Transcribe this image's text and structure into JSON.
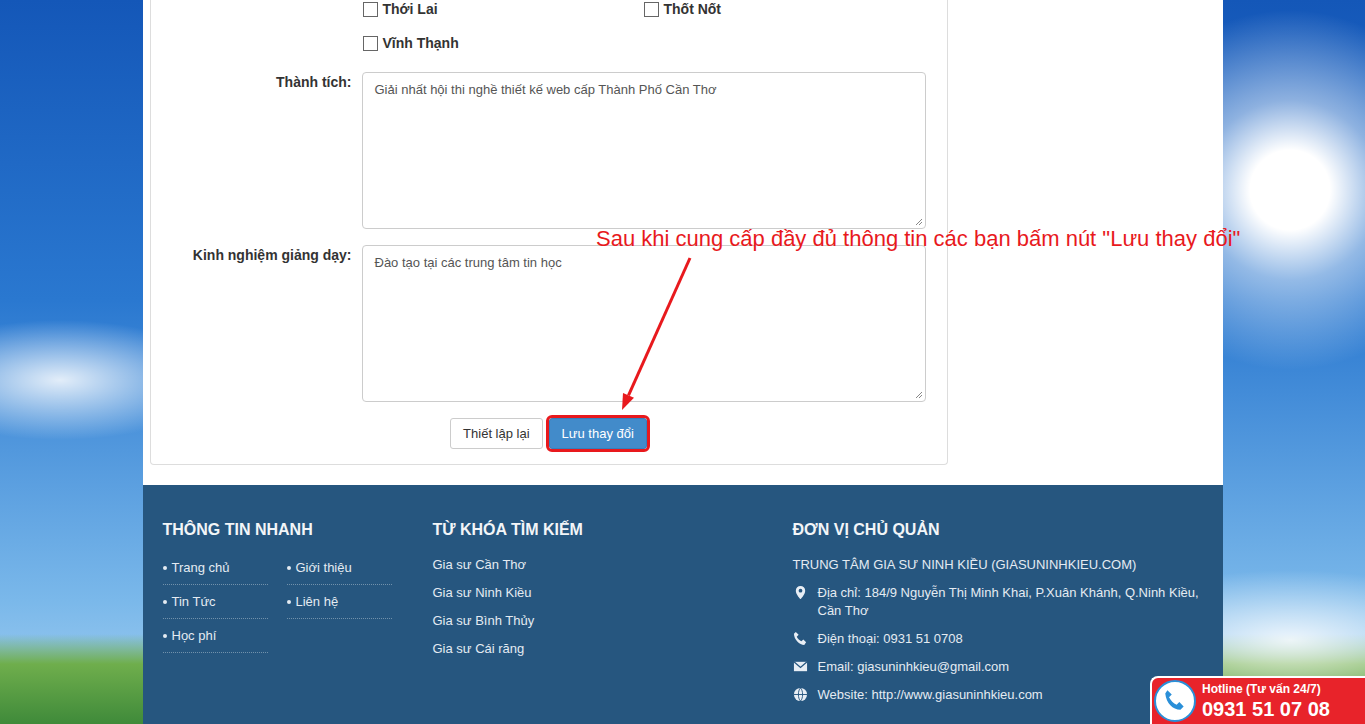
{
  "districts": [
    {
      "label": "Thới Lai",
      "checked": false
    },
    {
      "label": "Thốt Nốt",
      "checked": false
    },
    {
      "label": "Vĩnh Thạnh",
      "checked": false
    }
  ],
  "fields": [
    {
      "label": "Thành tích:",
      "value": "Giải nhất hội thi nghề thiết kế web cấp Thành Phố Cần Thơ"
    },
    {
      "label": "Kinh nghiệm giảng dạy:",
      "value": "Đào tạo tại các trung tâm tin học"
    }
  ],
  "buttons": {
    "reset": "Thiết lập lại",
    "save": "Lưu thay đổi"
  },
  "annotation": "Sau khi cung cấp đầy đủ thông tin các bạn bấm nút \"Lưu thay đổi\"",
  "footer": {
    "quick_info": {
      "title": "THÔNG TIN NHANH",
      "links": [
        "Trang chủ",
        "Giới thiệu",
        "Tin Tức",
        "Liên hệ",
        "Học phí"
      ]
    },
    "keywords": {
      "title": "TỪ KHÓA TÌM KIẾM",
      "links": [
        "Gia sư Cần Thơ",
        "Gia sư Ninh Kiều",
        "Gia sư Bình Thủy",
        "Gia sư Cái răng"
      ]
    },
    "owner": {
      "title": "ĐƠN VỊ CHỦ QUẢN",
      "name": "TRUNG TÂM GIA SƯ NINH KIỀU (GIASUNINHKIEU.COM)",
      "contacts": [
        {
          "kind": "address",
          "text": "Địa chỉ: 184/9 Nguyễn Thị Minh Khai, P.Xuân Khánh, Q.Ninh Kiều, Cần Thơ"
        },
        {
          "kind": "phone",
          "text": "Điện thoại: 0931 51 0708"
        },
        {
          "kind": "email",
          "text": "Email: giasuninhkieu@gmail.com"
        },
        {
          "kind": "website",
          "text": "Website: http://www.giasuninhkieu.com"
        }
      ]
    }
  },
  "hotline": {
    "label": "Hotline (Tư vấn 24/7)",
    "number": "0931 51 07 08"
  }
}
